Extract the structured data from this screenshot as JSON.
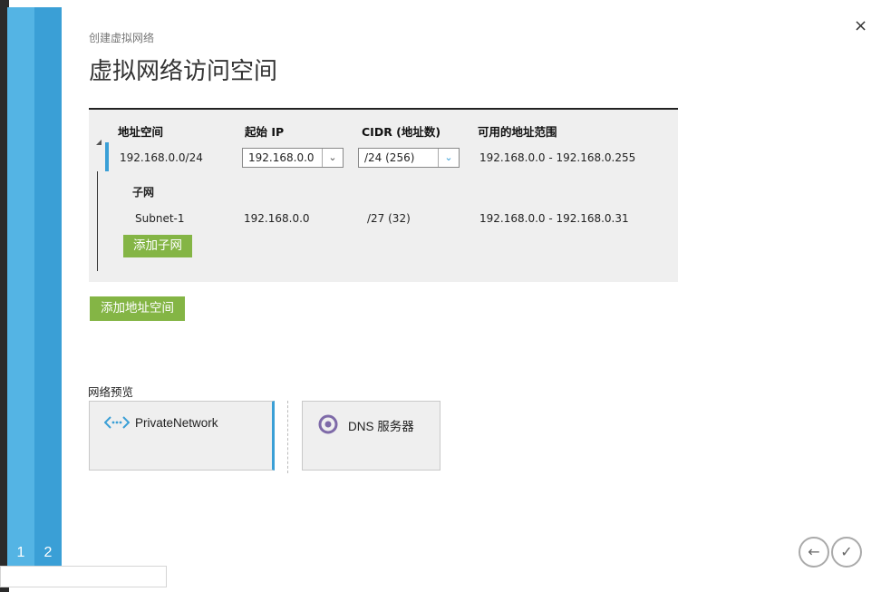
{
  "wizard": {
    "steps": [
      "1",
      "2"
    ]
  },
  "dialog": {
    "breadcrumb": "创建虚拟网络",
    "title": "虚拟网络访问空间",
    "close_icon": "×"
  },
  "address_table": {
    "headers": {
      "address_space": "地址空间",
      "start_ip": "起始 IP",
      "cidr": "CIDR (地址数)",
      "usable_range": "可用的地址范围"
    },
    "row": {
      "address_space": "192.168.0.0/24",
      "start_ip": "192.168.0.0",
      "cidr": "/24 (256)",
      "usable_range": "192.168.0.0 - 192.168.0.255"
    },
    "subnet_header": "子网",
    "subnet": {
      "name": "Subnet-1",
      "start_ip": "192.168.0.0",
      "cidr": "/27 (32)",
      "usable_range": "192.168.0.0 - 192.168.0.31"
    },
    "add_subnet_label": "添加子网"
  },
  "add_address_space_label": "添加地址空间",
  "network_preview": {
    "label": "网络预览",
    "network_name": "PrivateNetwork",
    "network_icon": "virtual-network-icon",
    "dns_label": "DNS 服务器",
    "dns_icon": "dns-server-icon"
  },
  "nav": {
    "back_icon": "←",
    "done_icon": "✓"
  },
  "colors": {
    "accent_blue": "#3a9fd6",
    "light_blue": "#54b4e4",
    "green_button": "#84b545",
    "dns_purple": "#7e6aa8"
  }
}
